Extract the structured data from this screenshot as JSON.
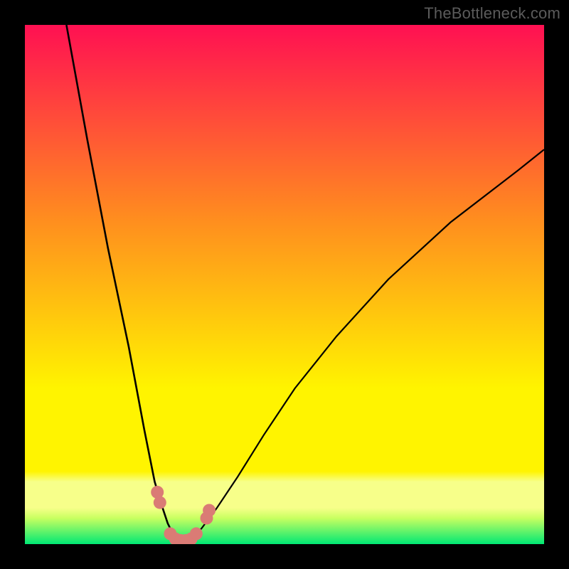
{
  "watermark": "TheBottleneck.com",
  "colors": {
    "black": "#000000",
    "curve": "#000000",
    "marker": "#da7b75",
    "gradient_top": "#ff1052",
    "gradient_mid1": "#ff8f1e",
    "gradient_mid2": "#fff400",
    "gradient_band": "#f7ff8a",
    "gradient_green": "#00e874"
  },
  "chart_data": {
    "type": "line",
    "title": "",
    "xlabel": "",
    "ylabel": "",
    "xlim": [
      0,
      100
    ],
    "ylim": [
      0,
      100
    ],
    "series": [
      {
        "name": "left-branch",
        "x": [
          8,
          12,
          16,
          20,
          23,
          25,
          26.5,
          27.5,
          28.5,
          29.5,
          30.5
        ],
        "y": [
          100,
          78,
          57,
          38,
          22,
          12,
          7,
          4,
          2,
          1,
          0.5
        ]
      },
      {
        "name": "right-branch",
        "x": [
          30.5,
          32,
          34,
          37,
          41,
          46,
          52,
          60,
          70,
          82,
          95,
          100
        ],
        "y": [
          0.5,
          1,
          3,
          7,
          13,
          21,
          30,
          40,
          51,
          62,
          72,
          76
        ]
      }
    ],
    "markers": {
      "name": "highlight-dots",
      "points": [
        {
          "x": 25.5,
          "y": 10
        },
        {
          "x": 26,
          "y": 8
        },
        {
          "x": 28,
          "y": 2
        },
        {
          "x": 29,
          "y": 1
        },
        {
          "x": 30,
          "y": 0.7
        },
        {
          "x": 31,
          "y": 0.7
        },
        {
          "x": 32,
          "y": 1
        },
        {
          "x": 33,
          "y": 2
        },
        {
          "x": 35,
          "y": 5
        },
        {
          "x": 35.5,
          "y": 6.5
        }
      ]
    }
  }
}
